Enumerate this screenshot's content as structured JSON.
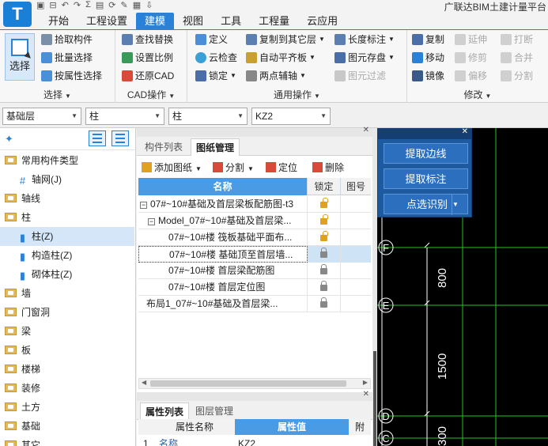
{
  "app": {
    "logo_letter": "T",
    "title": "广联达BIM土建计量平台",
    "quick_access": [
      "▣",
      "⊟",
      "↶",
      "↷",
      "Σ",
      "▤",
      "⟳",
      "✎",
      "▦",
      "⇩"
    ]
  },
  "tabs": [
    "开始",
    "工程设置",
    "建模",
    "视图",
    "工具",
    "工程量",
    "云应用"
  ],
  "active_tab": "建模",
  "ribbon": {
    "select_group": {
      "big_button": "选择",
      "items": [
        "拾取构件",
        "批量选择",
        "按属性选择"
      ],
      "label": "选择"
    },
    "cad_group": {
      "items": [
        "查找替换",
        "设置比例",
        "还原CAD"
      ],
      "label": "CAD操作"
    },
    "common_group": {
      "items": [
        "定义",
        "云检查",
        "锁定",
        "复制到其它层",
        "自动平齐板",
        "两点辅轴",
        "长度标注",
        "图元存盘",
        "图元过滤"
      ],
      "label": "通用操作"
    },
    "modify_group": {
      "items": [
        "复制",
        "移动",
        "镜像",
        "延伸",
        "修剪",
        "偏移",
        "打断",
        "合并",
        "分割"
      ],
      "label": "修改"
    }
  },
  "selectors": {
    "floor": "基础层",
    "category": "柱",
    "type": "柱",
    "member": "KZ2"
  },
  "left_tree": [
    {
      "label": "常用构件类型",
      "level": 0
    },
    {
      "label": "轴网(J)",
      "level": 1
    },
    {
      "label": "轴线",
      "level": 0
    },
    {
      "label": "柱",
      "level": 0
    },
    {
      "label": "柱(Z)",
      "level": 1,
      "selected": true
    },
    {
      "label": "构造柱(Z)",
      "level": 1
    },
    {
      "label": "砌体柱(Z)",
      "level": 1
    },
    {
      "label": "墙",
      "level": 0
    },
    {
      "label": "门窗洞",
      "level": 0
    },
    {
      "label": "梁",
      "level": 0
    },
    {
      "label": "板",
      "level": 0
    },
    {
      "label": "楼梯",
      "level": 0
    },
    {
      "label": "装修",
      "level": 0
    },
    {
      "label": "土方",
      "level": 0
    },
    {
      "label": "基础",
      "level": 0
    },
    {
      "label": "其它",
      "level": 0
    }
  ],
  "drawing_panel": {
    "tabs": [
      "构件列表",
      "图纸管理"
    ],
    "active_tab": "图纸管理",
    "toolbar": {
      "add": "添加图纸",
      "split": "分割",
      "locate": "定位",
      "delete": "删除"
    },
    "columns": {
      "name": "名称",
      "lock": "锁定",
      "page": "图号"
    },
    "rows": [
      {
        "name": "07#~10#基础及首层梁板配筋图-t3",
        "indent": 0,
        "expander": "−",
        "lock": "open"
      },
      {
        "name": "Model_07#~10#基础及首层梁...",
        "indent": 1,
        "expander": "−",
        "lock": "open"
      },
      {
        "name": "07#~10#楼 筏板基础平面布...",
        "indent": 2,
        "lock": "open"
      },
      {
        "name": "07#~10#楼 基础顶至首层墙...",
        "indent": 2,
        "lock": "closed",
        "selected": true
      },
      {
        "name": "07#~10#楼 首层梁配筋图",
        "indent": 2,
        "lock": "closed"
      },
      {
        "name": "07#~10#楼 首层定位图",
        "indent": 2,
        "lock": "closed"
      },
      {
        "name": "布局1_07#~10#基础及首层梁...",
        "indent": 1,
        "lock": "closed"
      }
    ]
  },
  "property_panel": {
    "tabs": [
      "属性列表",
      "图层管理"
    ],
    "active_tab": "属性列表",
    "columns": {
      "name": "属性名称",
      "value": "属性值",
      "extra": "附"
    },
    "rows": [
      {
        "index": "1",
        "name": "名称",
        "value": "KZ2"
      }
    ]
  },
  "cad_panel": {
    "buttons": [
      "提取边线",
      "提取标注",
      "点选识别"
    ]
  },
  "canvas": {
    "axis_labels": [
      "F",
      "E",
      "D",
      "C"
    ],
    "dimensions": [
      "800",
      "1500",
      "300"
    ]
  },
  "colors": {
    "accent": "#2a82d8",
    "canvas_bg": "#000000",
    "grid_line": "#22c422",
    "panel_blue": "#1e5aa0"
  }
}
